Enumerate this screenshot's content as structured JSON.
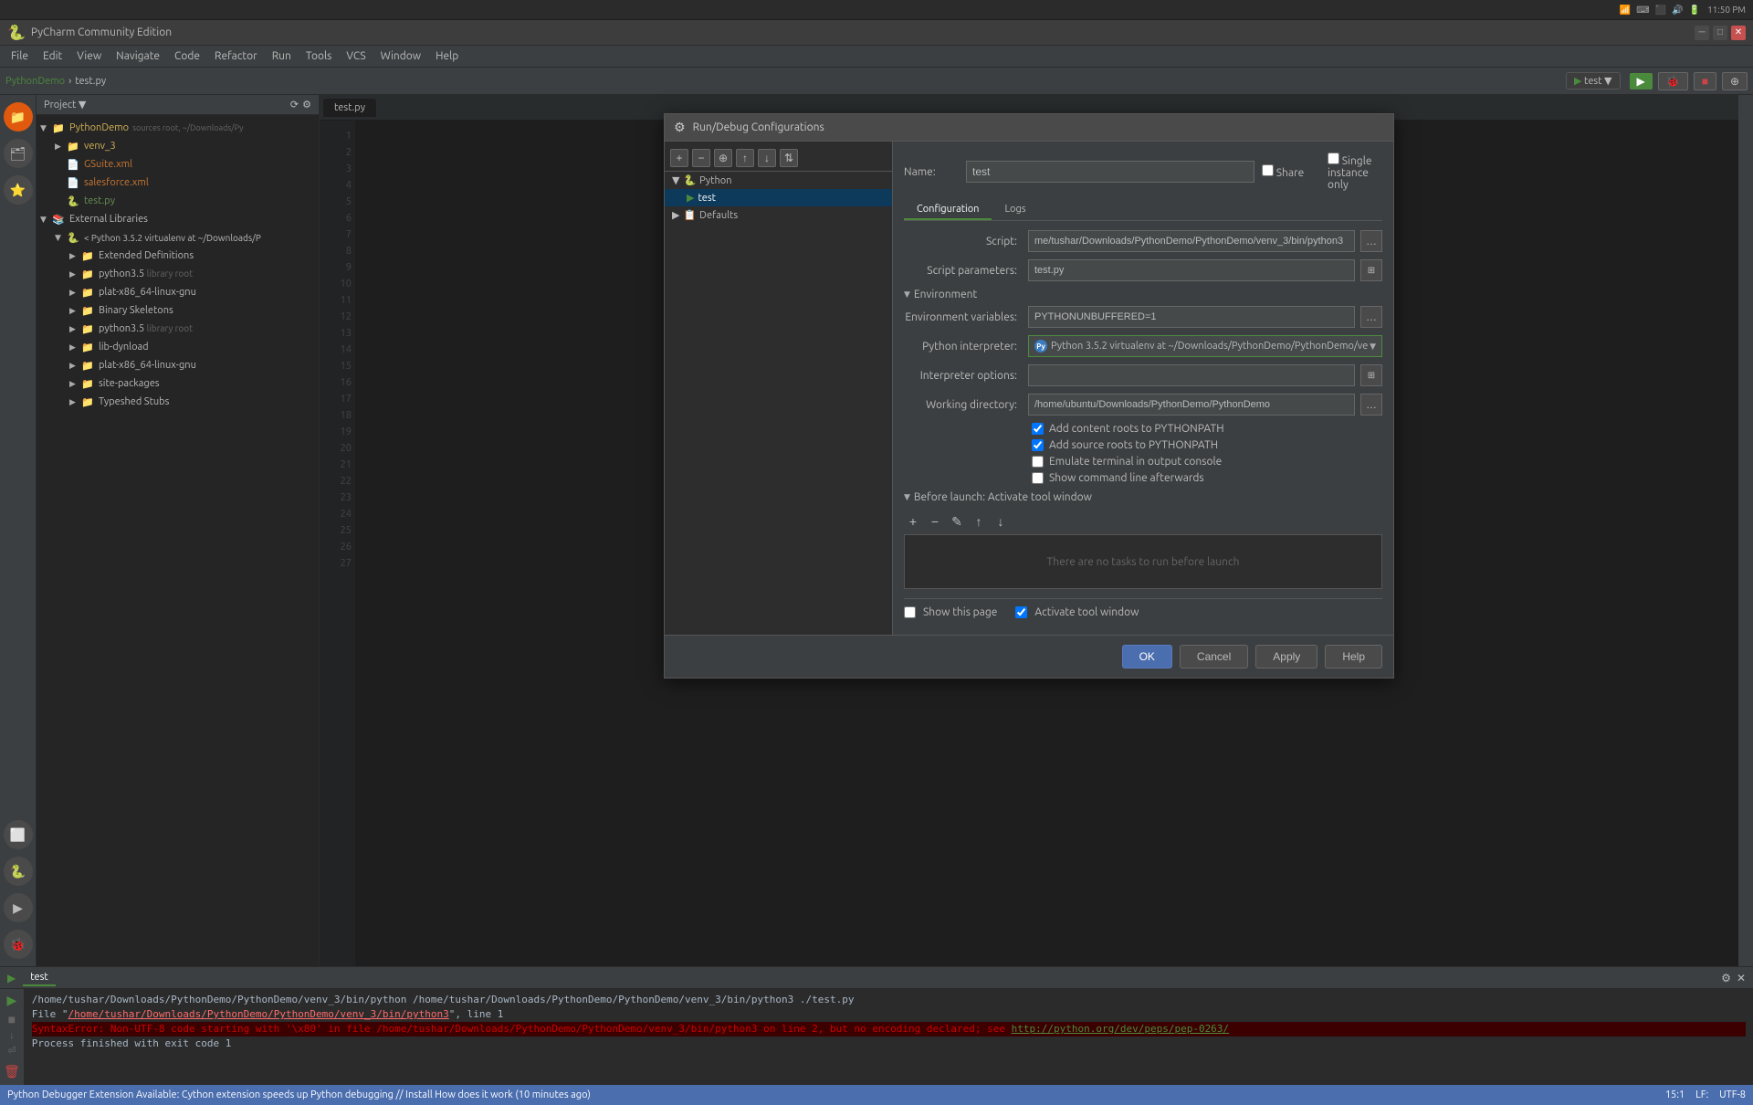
{
  "app": {
    "title": "PycharmCommunityEdition",
    "window_title": "PyCharm Community Edition"
  },
  "system_bar": {
    "time": "11:50 PM",
    "date": "PM"
  },
  "menu": {
    "items": [
      "File",
      "Edit",
      "View",
      "Navigate",
      "Code",
      "Refactor",
      "Run",
      "Tools",
      "VCS",
      "Window",
      "Help"
    ]
  },
  "breadcrumb": {
    "project": "PythonDemo",
    "file": "test.py"
  },
  "project_panel": {
    "header": "Project",
    "items": [
      {
        "label": "PythonDemo",
        "type": "folder",
        "indent": 0
      },
      {
        "label": "venv_3",
        "type": "folder",
        "indent": 1
      },
      {
        "label": "GSuite.xml",
        "type": "xml",
        "indent": 1
      },
      {
        "label": "salesforce.xml",
        "type": "xml",
        "indent": 1
      },
      {
        "label": "test.py",
        "type": "python",
        "indent": 1
      },
      {
        "label": "External Libraries",
        "type": "folder",
        "indent": 0
      },
      {
        "label": "< Python 3.5.2 virtualenv at ~/Downloads/P",
        "type": "folder",
        "indent": 1
      },
      {
        "label": "Extended Definitions",
        "type": "folder",
        "indent": 2
      },
      {
        "label": "python3.5",
        "type": "folder",
        "indent": 2
      },
      {
        "label": "plat-x86_64-linux-gnu",
        "type": "folder",
        "indent": 2
      },
      {
        "label": "Binary Skeletons",
        "type": "folder",
        "indent": 2
      },
      {
        "label": "python3.5",
        "type": "folder",
        "indent": 2
      },
      {
        "label": "lib-dynload",
        "type": "folder",
        "indent": 2
      },
      {
        "label": "plat-x86_64-linux-gnu",
        "type": "folder",
        "indent": 2
      },
      {
        "label": "site-packages",
        "type": "folder",
        "indent": 2
      },
      {
        "label": "Typeshed Stubs",
        "type": "folder",
        "indent": 2
      }
    ]
  },
  "dialog": {
    "title": "Run/Debug Configurations",
    "name_label": "Name:",
    "name_value": "test",
    "share_label": "Share",
    "single_instance_label": "Single instance only",
    "tabs": [
      "Configuration",
      "Logs"
    ],
    "active_tab": "Configuration",
    "form": {
      "script_label": "Script:",
      "script_value": "me/tushar/Downloads/PythonDemo/PythonDemo/venv_3/bin/python3",
      "script_params_label": "Script parameters:",
      "script_params_value": "test.py",
      "env_section_label": "Environment",
      "env_vars_label": "Environment variables:",
      "env_vars_value": "PYTHONUNBUFFERED=1",
      "python_interpreter_label": "Python interpreter:",
      "python_interpreter_value": "Python 3.5.2 virtualenv at ~/Downloads/PythonDemo/PythonDemo/ve",
      "interpreter_options_label": "Interpreter options:",
      "interpreter_options_value": "",
      "working_dir_label": "Working directory:",
      "working_dir_value": "/home/ubuntu/Downloads/PythonDemo/PythonDemo",
      "add_content_roots_label": "Add content roots to PYTHONPATH",
      "add_content_roots_checked": true,
      "add_source_roots_label": "Add source roots to PYTHONPATH",
      "add_source_roots_checked": true,
      "emulate_terminal_label": "Emulate terminal in output console",
      "emulate_terminal_checked": false,
      "show_cmdline_label": "Show command line afterwards",
      "show_cmdline_checked": false,
      "before_launch_label": "Before launch: Activate tool window",
      "no_tasks_text": "There are no tasks to run before launch",
      "show_page_label": "Show this page",
      "show_page_checked": false,
      "activate_tool_window_label": "Activate tool window",
      "activate_tool_window_checked": true
    },
    "config_tree": {
      "items": [
        {
          "label": "Python",
          "type": "group",
          "indent": 0
        },
        {
          "label": "test",
          "type": "config",
          "indent": 1
        },
        {
          "label": "Defaults",
          "type": "group",
          "indent": 0
        }
      ]
    },
    "buttons": {
      "ok": "OK",
      "cancel": "Cancel",
      "apply": "Apply",
      "help": "Help"
    }
  },
  "run_panel": {
    "tab": "test",
    "run_label": "Run",
    "output_lines": [
      "/home/tushar/Downloads/PythonDemo/PythonDemo/venv_3/bin/python /home/tushar/Downloads/PythonDemo/PythonDemo/venv_3/bin/python3 ./test.py",
      "File \"/home/tushar/Downloads/PythonDemo/PythonDemo/venv_3/bin/python3\", line 1",
      "SyntaxError: Non-UTF-8 code starting with '\\x80' in file /home/tushar/Downloads/PythonDemo/PythonDemo/venv_3/bin/python3 on line 2, but no encoding declared; see http://python.org/dev/peps/pep-0263/",
      "Process finished with exit code 1"
    ],
    "error_line": "SyntaxError: Non-UTF-8 code starting with '\\x80' in file /home/tushar/Downloads/PythonDemo/PythonDemo/venv_3/bin/python3 on line 2, but no encoding declared; see",
    "pep_link": "http://python.org/dev/peps/pep-0263/"
  },
  "status_bar": {
    "message": "Python Debugger Extension Available: Cython extension speeds up Python debugging // Install How does it work (10 minutes ago)",
    "position": "15:1",
    "lf": "LF:",
    "encoding": "UTF-8"
  },
  "editor_tabs": [
    "test.py"
  ],
  "toolbar_run": {
    "config_name": "test",
    "buttons": [
      "run",
      "debug",
      "stop",
      "coverage"
    ]
  },
  "lines": [
    "1",
    "2",
    "3",
    "4",
    "5",
    "6",
    "7",
    "8",
    "9",
    "10",
    "11",
    "12",
    "13",
    "14",
    "15",
    "16",
    "17",
    "18",
    "19",
    "20",
    "21",
    "22",
    "23",
    "24",
    "25",
    "26",
    "27"
  ]
}
